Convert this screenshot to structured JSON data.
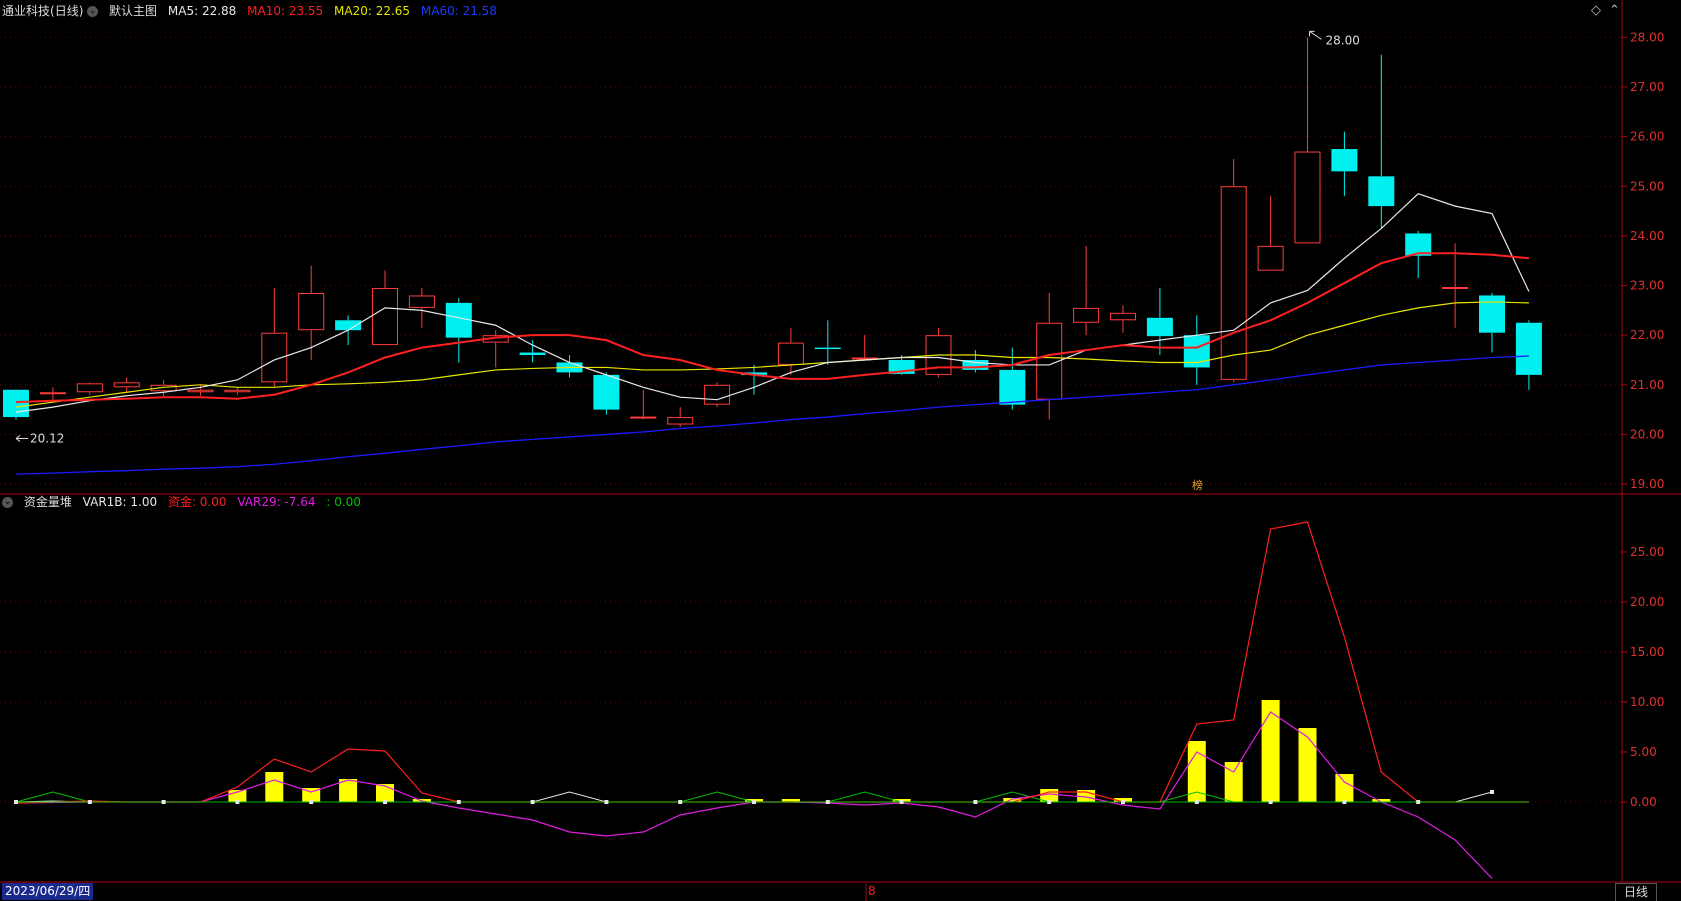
{
  "header_main": {
    "stock_name": "通业科技",
    "period_label": "(日线)",
    "template_label": "默认主图",
    "ma5_label": "MA5: 22.88",
    "ma10_label": "MA10: 23.55",
    "ma20_label": "MA20: 22.65",
    "ma60_label": "MA60: 21.58"
  },
  "header_sub": {
    "indicator_label": "资金量堆",
    "var1b_label": "VAR1B: 1.00",
    "zijin_label": "资金: 0.00",
    "var29_label": "VAR29: -7.64",
    "extra_label": ": 0.00"
  },
  "footer": {
    "date_label": "2023/06/29/四",
    "month_label": "8",
    "period_button": "日线"
  },
  "colors": {
    "up": "#ff3b3b",
    "down": "#00f0f0",
    "ma5": "#e8e8e8",
    "ma10": "#ff2020",
    "ma20": "#e6e600",
    "ma60": "#1a1aff",
    "axis": "#b0000a",
    "grid": "#5a0a0a",
    "zijin": "#ff1e1e",
    "var29": "#e01ee0",
    "volbar": "#ffff00",
    "green": "#00c000"
  },
  "chart_data": [
    {
      "type": "candlestick",
      "y_ticks": [
        "19.00",
        "20.00",
        "21.00",
        "22.00",
        "23.00",
        "24.00",
        "25.00",
        "26.00",
        "27.00",
        "28.00"
      ],
      "ylim": [
        18.8,
        28.35
      ],
      "annotations": {
        "high": "28.00",
        "low": "20.12",
        "tag": "榜"
      },
      "candles": [
        [
          20.9,
          20.35,
          20.9,
          20.3
        ],
        [
          20.83,
          20.85,
          20.95,
          20.7
        ],
        [
          20.85,
          21.03,
          21.05,
          20.8
        ],
        [
          20.95,
          21.05,
          21.15,
          20.85
        ],
        [
          20.87,
          21.0,
          21.1,
          20.75
        ],
        [
          20.85,
          20.9,
          20.98,
          20.78
        ],
        [
          20.85,
          20.9,
          20.95,
          20.8
        ],
        [
          21.05,
          22.05,
          22.95,
          20.95
        ],
        [
          22.1,
          22.85,
          23.4,
          21.5
        ],
        [
          22.3,
          22.1,
          22.4,
          21.8
        ],
        [
          21.8,
          22.95,
          23.3,
          21.8
        ],
        [
          22.55,
          22.8,
          22.95,
          22.15
        ],
        [
          22.65,
          21.95,
          22.75,
          21.45
        ],
        [
          21.85,
          22.0,
          22.1,
          21.35
        ],
        [
          21.65,
          21.6,
          21.9,
          21.45
        ],
        [
          21.45,
          21.25,
          21.6,
          21.15
        ],
        [
          21.2,
          20.5,
          21.25,
          20.4
        ],
        [
          20.32,
          20.36,
          20.9,
          20.3
        ],
        [
          20.2,
          20.35,
          20.55,
          20.15
        ],
        [
          20.6,
          21.0,
          21.05,
          20.55
        ],
        [
          21.25,
          21.2,
          21.4,
          20.8
        ],
        [
          21.4,
          21.85,
          22.15,
          21.2
        ],
        [
          21.75,
          21.72,
          22.3,
          21.4
        ],
        [
          21.55,
          21.55,
          22.0,
          21.5
        ],
        [
          21.5,
          21.22,
          21.6,
          21.2
        ],
        [
          21.2,
          22.0,
          22.15,
          21.15
        ],
        [
          21.5,
          21.3,
          21.7,
          21.25
        ],
        [
          21.3,
          20.6,
          21.75,
          20.5
        ],
        [
          20.7,
          22.25,
          22.85,
          20.3
        ],
        [
          22.25,
          22.55,
          23.8,
          22.0
        ],
        [
          22.3,
          22.45,
          22.6,
          22.05
        ],
        [
          22.35,
          21.98,
          22.95,
          21.6
        ],
        [
          22.0,
          21.35,
          22.4,
          21.0
        ],
        [
          21.1,
          25.0,
          25.55,
          21.05
        ],
        [
          23.3,
          23.8,
          24.8,
          23.3
        ],
        [
          23.85,
          25.7,
          28.0,
          23.85
        ],
        [
          25.75,
          25.3,
          26.1,
          24.8
        ],
        [
          25.2,
          24.6,
          27.65,
          24.15
        ],
        [
          24.05,
          23.6,
          24.1,
          23.15
        ],
        [
          22.97,
          22.97,
          23.85,
          22.15
        ],
        [
          22.8,
          22.05,
          22.85,
          21.65
        ],
        [
          22.25,
          21.2,
          22.3,
          20.9
        ]
      ],
      "ma5": [
        20.45,
        20.55,
        20.68,
        20.78,
        20.85,
        20.95,
        21.1,
        21.5,
        21.75,
        22.1,
        22.55,
        22.5,
        22.35,
        22.2,
        21.8,
        21.45,
        21.2,
        20.95,
        20.75,
        20.7,
        20.95,
        21.25,
        21.45,
        21.5,
        21.55,
        21.55,
        21.45,
        21.4,
        21.4,
        21.7,
        21.8,
        21.9,
        22.0,
        22.1,
        22.65,
        22.9,
        23.55,
        24.15,
        24.85,
        24.6,
        24.45,
        22.88
      ],
      "ma10": [
        20.65,
        20.68,
        20.7,
        20.72,
        20.75,
        20.75,
        20.72,
        20.8,
        21.0,
        21.25,
        21.55,
        21.75,
        21.85,
        21.95,
        22.0,
        22.0,
        21.9,
        21.6,
        21.5,
        21.3,
        21.2,
        21.12,
        21.12,
        21.2,
        21.27,
        21.35,
        21.35,
        21.4,
        21.6,
        21.7,
        21.8,
        21.75,
        21.75,
        22.05,
        22.3,
        22.65,
        23.05,
        23.45,
        23.65,
        23.65,
        23.62,
        23.55
      ],
      "ma20": [
        20.55,
        20.65,
        20.75,
        20.85,
        20.95,
        21.0,
        20.95,
        20.95,
        21.0,
        21.02,
        21.05,
        21.1,
        21.2,
        21.3,
        21.33,
        21.35,
        21.35,
        21.3,
        21.3,
        21.32,
        21.35,
        21.4,
        21.45,
        21.5,
        21.55,
        21.6,
        21.6,
        21.55,
        21.55,
        21.52,
        21.48,
        21.45,
        21.45,
        21.6,
        21.7,
        22.0,
        22.2,
        22.4,
        22.55,
        22.65,
        22.67,
        22.65
      ],
      "ma60": [
        19.2,
        19.22,
        19.25,
        19.27,
        19.3,
        19.32,
        19.35,
        19.4,
        19.47,
        19.55,
        19.62,
        19.7,
        19.77,
        19.85,
        19.9,
        19.95,
        20.0,
        20.05,
        20.12,
        20.17,
        20.23,
        20.3,
        20.35,
        20.42,
        20.48,
        20.55,
        20.6,
        20.65,
        20.7,
        20.75,
        20.8,
        20.85,
        20.9,
        21.0,
        21.1,
        21.2,
        21.3,
        21.4,
        21.45,
        21.5,
        21.55,
        21.58
      ]
    },
    {
      "type": "bar_line",
      "name": "资金量堆",
      "y_ticks": [
        "0.00",
        "5.00",
        "10.00",
        "15.00",
        "20.00",
        "25.00"
      ],
      "ylim": [
        -8.0,
        29.0
      ],
      "bars": [
        0,
        0,
        0,
        0,
        0,
        0,
        1.2,
        3.0,
        1.4,
        2.3,
        1.8,
        0.3,
        0,
        0,
        0,
        0,
        0,
        0,
        0,
        0,
        0.3,
        0.3,
        0,
        0,
        0.3,
        0,
        0,
        0.4,
        1.3,
        1.2,
        0.4,
        0,
        6.1,
        4.0,
        10.2,
        7.4,
        2.8,
        0.3,
        0,
        0,
        0,
        0
      ],
      "zijin": [
        -0.1,
        0,
        0.1,
        0,
        0,
        0,
        1.5,
        4.3,
        3.0,
        5.3,
        5.1,
        0.9,
        0,
        0,
        0,
        0,
        0,
        0,
        0,
        0,
        0,
        0,
        0,
        0,
        0,
        0,
        0,
        0,
        1.0,
        1.0,
        0,
        0,
        7.8,
        8.2,
        27.3,
        28.0,
        16.5,
        3.0,
        0,
        0,
        0,
        0
      ],
      "var29": [
        -0.1,
        -0.05,
        0,
        0,
        0,
        0,
        1.0,
        2.2,
        1.0,
        2.2,
        1.6,
        0.1,
        -0.6,
        -1.2,
        -1.8,
        -3.0,
        -3.4,
        -3.0,
        -1.3,
        -0.6,
        0,
        0,
        -0.1,
        -0.3,
        -0.1,
        -0.5,
        -1.5,
        0.3,
        0.8,
        0.5,
        -0.3,
        -0.7,
        5.0,
        3.0,
        9.0,
        6.5,
        2.0,
        0,
        -1.5,
        -3.8,
        -7.64
      ],
      "var1b": [
        0,
        0.1,
        0,
        0,
        0,
        0,
        0,
        0,
        0,
        0,
        0,
        0,
        0,
        0,
        0,
        1.0,
        0,
        0,
        0,
        0,
        0,
        0,
        0,
        0,
        0,
        0,
        0,
        0,
        0,
        0,
        0,
        0,
        0,
        0,
        0,
        0,
        0,
        0,
        0,
        0,
        1.0
      ],
      "green": [
        0,
        1.0,
        0,
        0,
        0,
        0,
        0,
        0,
        0,
        0,
        0,
        0,
        0,
        0,
        0,
        0,
        0,
        0,
        0,
        1.0,
        0,
        0,
        0,
        1.0,
        0,
        0,
        0,
        1.0,
        0,
        0,
        0,
        0,
        1.0,
        0,
        0,
        0,
        0,
        0,
        0,
        0,
        0,
        0
      ]
    }
  ]
}
